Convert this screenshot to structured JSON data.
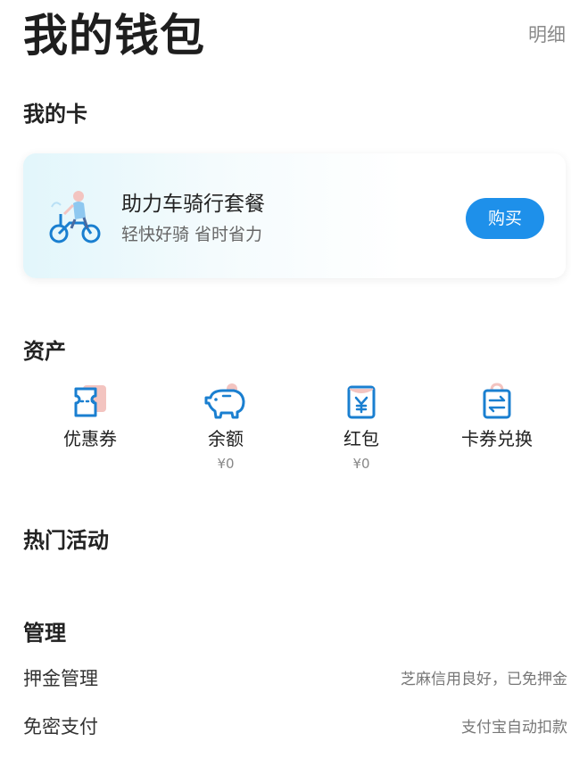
{
  "header": {
    "title": "我的钱包",
    "detail_link": "明细"
  },
  "my_cards": {
    "section_title": "我的卡",
    "card": {
      "title": "助力车骑行套餐",
      "subtitle": "轻快好骑 省时省力",
      "buy_label": "购买",
      "illustration": "person-on-scooter-illustration"
    }
  },
  "assets": {
    "section_title": "资产",
    "items": [
      {
        "label": "优惠券",
        "value": "",
        "icon": "coupon-icon"
      },
      {
        "label": "余额",
        "value": "¥0",
        "icon": "piggy-bank-icon"
      },
      {
        "label": "红包",
        "value": "¥0",
        "icon": "red-envelope-icon"
      },
      {
        "label": "卡券兑换",
        "value": "",
        "icon": "exchange-bag-icon"
      }
    ]
  },
  "hot_activities": {
    "section_title": "热门活动"
  },
  "manage": {
    "section_title": "管理",
    "items": [
      {
        "label": "押金管理",
        "value": "芝麻信用良好，已免押金"
      },
      {
        "label": "免密支付",
        "value": "支付宝自动扣款"
      }
    ]
  },
  "colors": {
    "accent": "#1e90ea",
    "icon_blue": "#1a7fd0",
    "icon_light_blue": "#cfe6f7",
    "icon_pink": "#f3c4c0",
    "card_gradient_start": "#e2f6fb"
  }
}
